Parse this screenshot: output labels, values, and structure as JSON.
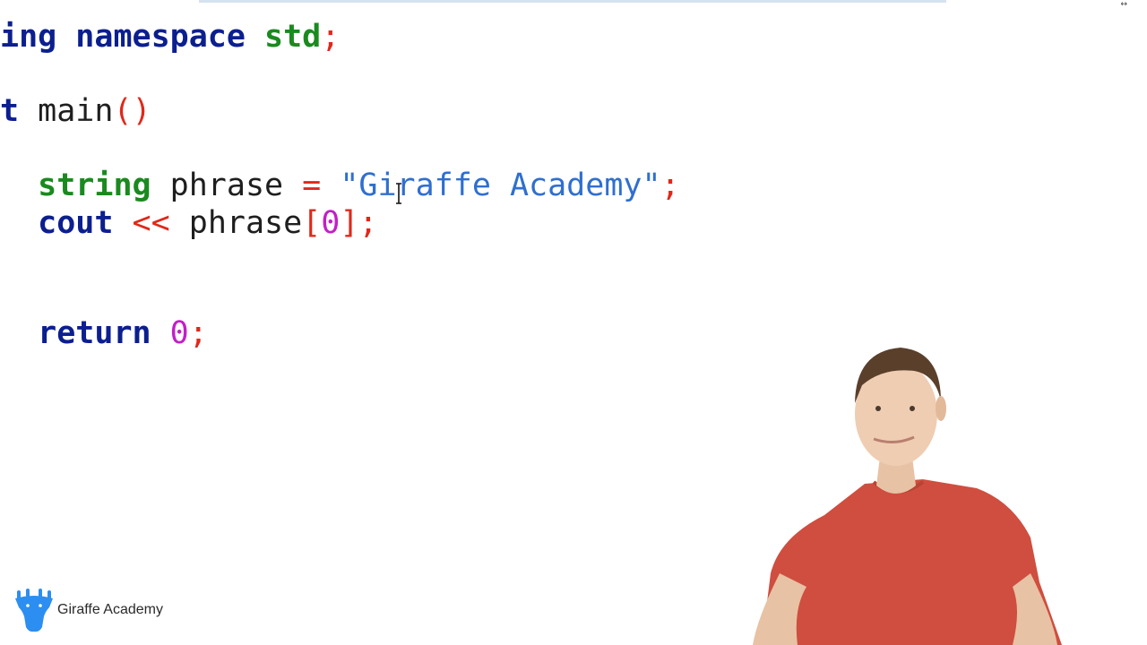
{
  "editor": {
    "lines": [
      {
        "tokens": [
          {
            "text": "ing",
            "cls": "kw"
          },
          {
            "text": " ",
            "cls": "id"
          },
          {
            "text": "namespace",
            "cls": "kw"
          },
          {
            "text": " ",
            "cls": "id"
          },
          {
            "text": "std",
            "cls": "ty"
          },
          {
            "text": ";",
            "cls": "op"
          }
        ]
      },
      {
        "tokens": [
          {
            "text": "t",
            "cls": "kw"
          },
          {
            "text": " main",
            "cls": "id"
          },
          {
            "text": "()",
            "cls": "op"
          }
        ]
      },
      {
        "tokens": [
          {
            "text": "  ",
            "cls": "id"
          },
          {
            "text": "string",
            "cls": "ty"
          },
          {
            "text": " phrase ",
            "cls": "id"
          },
          {
            "text": "=",
            "cls": "op"
          },
          {
            "text": " \"Giraffe Academy\"",
            "cls": "str"
          },
          {
            "text": ";",
            "cls": "op"
          }
        ]
      },
      {
        "tokens": [
          {
            "text": "  ",
            "cls": "id"
          },
          {
            "text": "cout",
            "cls": "kw"
          },
          {
            "text": " ",
            "cls": "id"
          },
          {
            "text": "<<",
            "cls": "op"
          },
          {
            "text": " phrase",
            "cls": "id"
          },
          {
            "text": "[",
            "cls": "op"
          },
          {
            "text": "0",
            "cls": "num"
          },
          {
            "text": "];",
            "cls": "op"
          }
        ]
      },
      {
        "tokens": [
          {
            "text": "  ",
            "cls": "id"
          },
          {
            "text": "return",
            "cls": "kw"
          },
          {
            "text": " ",
            "cls": "id"
          },
          {
            "text": "0",
            "cls": "num"
          },
          {
            "text": ";",
            "cls": "op"
          }
        ]
      }
    ]
  },
  "logo": {
    "text": "Giraffe Academy"
  },
  "colors": {
    "keyword": "#0b1f8f",
    "type": "#1a8a1f",
    "operator": "#e0281a",
    "string": "#2f6fcf",
    "number": "#c21fc8",
    "logo_icon": "#2c8ef0"
  },
  "icons": {
    "corner": "resize-arrows-icon",
    "logo": "giraffe-logo-icon",
    "cursor": "text-cursor-icon"
  },
  "corner_mark": "↔"
}
